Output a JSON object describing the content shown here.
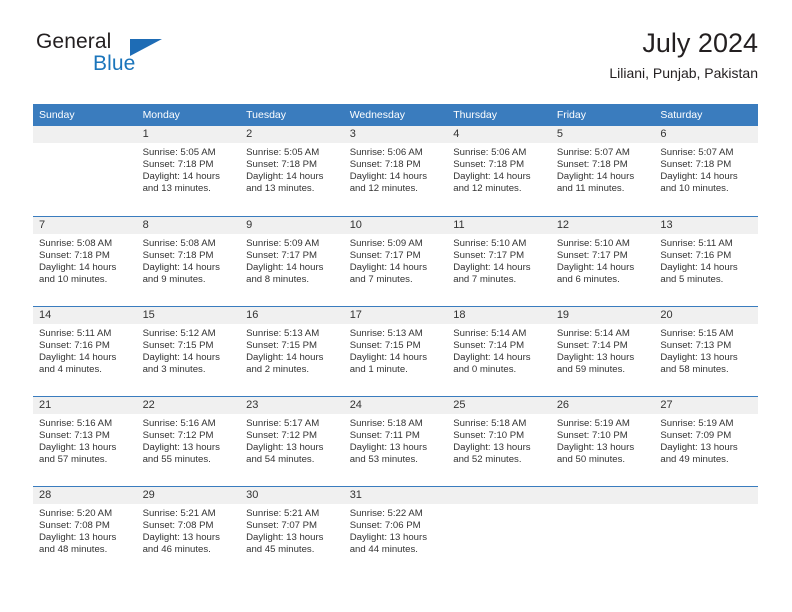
{
  "brand": {
    "name_part1": "General",
    "name_part2": "Blue",
    "triangle_color": "#1e6cb5",
    "blue_color": "#1b75bb"
  },
  "header": {
    "title": "July 2024",
    "subtitle": "Liliani, Punjab, Pakistan"
  },
  "colors": {
    "header_row_bg": "#3a7cbe",
    "header_row_text": "#ffffff",
    "daynum_strip_bg": "#f0f0f0",
    "row_separator": "#3a7cbe",
    "body_text": "#333333"
  },
  "weekday_headers": [
    "Sunday",
    "Monday",
    "Tuesday",
    "Wednesday",
    "Thursday",
    "Friday",
    "Saturday"
  ],
  "weeks": [
    [
      {
        "day": "",
        "sunrise": "",
        "sunset": "",
        "daylight1": "",
        "daylight2": ""
      },
      {
        "day": "1",
        "sunrise": "Sunrise: 5:05 AM",
        "sunset": "Sunset: 7:18 PM",
        "daylight1": "Daylight: 14 hours",
        "daylight2": "and 13 minutes."
      },
      {
        "day": "2",
        "sunrise": "Sunrise: 5:05 AM",
        "sunset": "Sunset: 7:18 PM",
        "daylight1": "Daylight: 14 hours",
        "daylight2": "and 13 minutes."
      },
      {
        "day": "3",
        "sunrise": "Sunrise: 5:06 AM",
        "sunset": "Sunset: 7:18 PM",
        "daylight1": "Daylight: 14 hours",
        "daylight2": "and 12 minutes."
      },
      {
        "day": "4",
        "sunrise": "Sunrise: 5:06 AM",
        "sunset": "Sunset: 7:18 PM",
        "daylight1": "Daylight: 14 hours",
        "daylight2": "and 12 minutes."
      },
      {
        "day": "5",
        "sunrise": "Sunrise: 5:07 AM",
        "sunset": "Sunset: 7:18 PM",
        "daylight1": "Daylight: 14 hours",
        "daylight2": "and 11 minutes."
      },
      {
        "day": "6",
        "sunrise": "Sunrise: 5:07 AM",
        "sunset": "Sunset: 7:18 PM",
        "daylight1": "Daylight: 14 hours",
        "daylight2": "and 10 minutes."
      }
    ],
    [
      {
        "day": "7",
        "sunrise": "Sunrise: 5:08 AM",
        "sunset": "Sunset: 7:18 PM",
        "daylight1": "Daylight: 14 hours",
        "daylight2": "and 10 minutes."
      },
      {
        "day": "8",
        "sunrise": "Sunrise: 5:08 AM",
        "sunset": "Sunset: 7:18 PM",
        "daylight1": "Daylight: 14 hours",
        "daylight2": "and 9 minutes."
      },
      {
        "day": "9",
        "sunrise": "Sunrise: 5:09 AM",
        "sunset": "Sunset: 7:17 PM",
        "daylight1": "Daylight: 14 hours",
        "daylight2": "and 8 minutes."
      },
      {
        "day": "10",
        "sunrise": "Sunrise: 5:09 AM",
        "sunset": "Sunset: 7:17 PM",
        "daylight1": "Daylight: 14 hours",
        "daylight2": "and 7 minutes."
      },
      {
        "day": "11",
        "sunrise": "Sunrise: 5:10 AM",
        "sunset": "Sunset: 7:17 PM",
        "daylight1": "Daylight: 14 hours",
        "daylight2": "and 7 minutes."
      },
      {
        "day": "12",
        "sunrise": "Sunrise: 5:10 AM",
        "sunset": "Sunset: 7:17 PM",
        "daylight1": "Daylight: 14 hours",
        "daylight2": "and 6 minutes."
      },
      {
        "day": "13",
        "sunrise": "Sunrise: 5:11 AM",
        "sunset": "Sunset: 7:16 PM",
        "daylight1": "Daylight: 14 hours",
        "daylight2": "and 5 minutes."
      }
    ],
    [
      {
        "day": "14",
        "sunrise": "Sunrise: 5:11 AM",
        "sunset": "Sunset: 7:16 PM",
        "daylight1": "Daylight: 14 hours",
        "daylight2": "and 4 minutes."
      },
      {
        "day": "15",
        "sunrise": "Sunrise: 5:12 AM",
        "sunset": "Sunset: 7:15 PM",
        "daylight1": "Daylight: 14 hours",
        "daylight2": "and 3 minutes."
      },
      {
        "day": "16",
        "sunrise": "Sunrise: 5:13 AM",
        "sunset": "Sunset: 7:15 PM",
        "daylight1": "Daylight: 14 hours",
        "daylight2": "and 2 minutes."
      },
      {
        "day": "17",
        "sunrise": "Sunrise: 5:13 AM",
        "sunset": "Sunset: 7:15 PM",
        "daylight1": "Daylight: 14 hours",
        "daylight2": "and 1 minute."
      },
      {
        "day": "18",
        "sunrise": "Sunrise: 5:14 AM",
        "sunset": "Sunset: 7:14 PM",
        "daylight1": "Daylight: 14 hours",
        "daylight2": "and 0 minutes."
      },
      {
        "day": "19",
        "sunrise": "Sunrise: 5:14 AM",
        "sunset": "Sunset: 7:14 PM",
        "daylight1": "Daylight: 13 hours",
        "daylight2": "and 59 minutes."
      },
      {
        "day": "20",
        "sunrise": "Sunrise: 5:15 AM",
        "sunset": "Sunset: 7:13 PM",
        "daylight1": "Daylight: 13 hours",
        "daylight2": "and 58 minutes."
      }
    ],
    [
      {
        "day": "21",
        "sunrise": "Sunrise: 5:16 AM",
        "sunset": "Sunset: 7:13 PM",
        "daylight1": "Daylight: 13 hours",
        "daylight2": "and 57 minutes."
      },
      {
        "day": "22",
        "sunrise": "Sunrise: 5:16 AM",
        "sunset": "Sunset: 7:12 PM",
        "daylight1": "Daylight: 13 hours",
        "daylight2": "and 55 minutes."
      },
      {
        "day": "23",
        "sunrise": "Sunrise: 5:17 AM",
        "sunset": "Sunset: 7:12 PM",
        "daylight1": "Daylight: 13 hours",
        "daylight2": "and 54 minutes."
      },
      {
        "day": "24",
        "sunrise": "Sunrise: 5:18 AM",
        "sunset": "Sunset: 7:11 PM",
        "daylight1": "Daylight: 13 hours",
        "daylight2": "and 53 minutes."
      },
      {
        "day": "25",
        "sunrise": "Sunrise: 5:18 AM",
        "sunset": "Sunset: 7:10 PM",
        "daylight1": "Daylight: 13 hours",
        "daylight2": "and 52 minutes."
      },
      {
        "day": "26",
        "sunrise": "Sunrise: 5:19 AM",
        "sunset": "Sunset: 7:10 PM",
        "daylight1": "Daylight: 13 hours",
        "daylight2": "and 50 minutes."
      },
      {
        "day": "27",
        "sunrise": "Sunrise: 5:19 AM",
        "sunset": "Sunset: 7:09 PM",
        "daylight1": "Daylight: 13 hours",
        "daylight2": "and 49 minutes."
      }
    ],
    [
      {
        "day": "28",
        "sunrise": "Sunrise: 5:20 AM",
        "sunset": "Sunset: 7:08 PM",
        "daylight1": "Daylight: 13 hours",
        "daylight2": "and 48 minutes."
      },
      {
        "day": "29",
        "sunrise": "Sunrise: 5:21 AM",
        "sunset": "Sunset: 7:08 PM",
        "daylight1": "Daylight: 13 hours",
        "daylight2": "and 46 minutes."
      },
      {
        "day": "30",
        "sunrise": "Sunrise: 5:21 AM",
        "sunset": "Sunset: 7:07 PM",
        "daylight1": "Daylight: 13 hours",
        "daylight2": "and 45 minutes."
      },
      {
        "day": "31",
        "sunrise": "Sunrise: 5:22 AM",
        "sunset": "Sunset: 7:06 PM",
        "daylight1": "Daylight: 13 hours",
        "daylight2": "and 44 minutes."
      },
      {
        "day": "",
        "sunrise": "",
        "sunset": "",
        "daylight1": "",
        "daylight2": ""
      },
      {
        "day": "",
        "sunrise": "",
        "sunset": "",
        "daylight1": "",
        "daylight2": ""
      },
      {
        "day": "",
        "sunrise": "",
        "sunset": "",
        "daylight1": "",
        "daylight2": ""
      }
    ]
  ]
}
